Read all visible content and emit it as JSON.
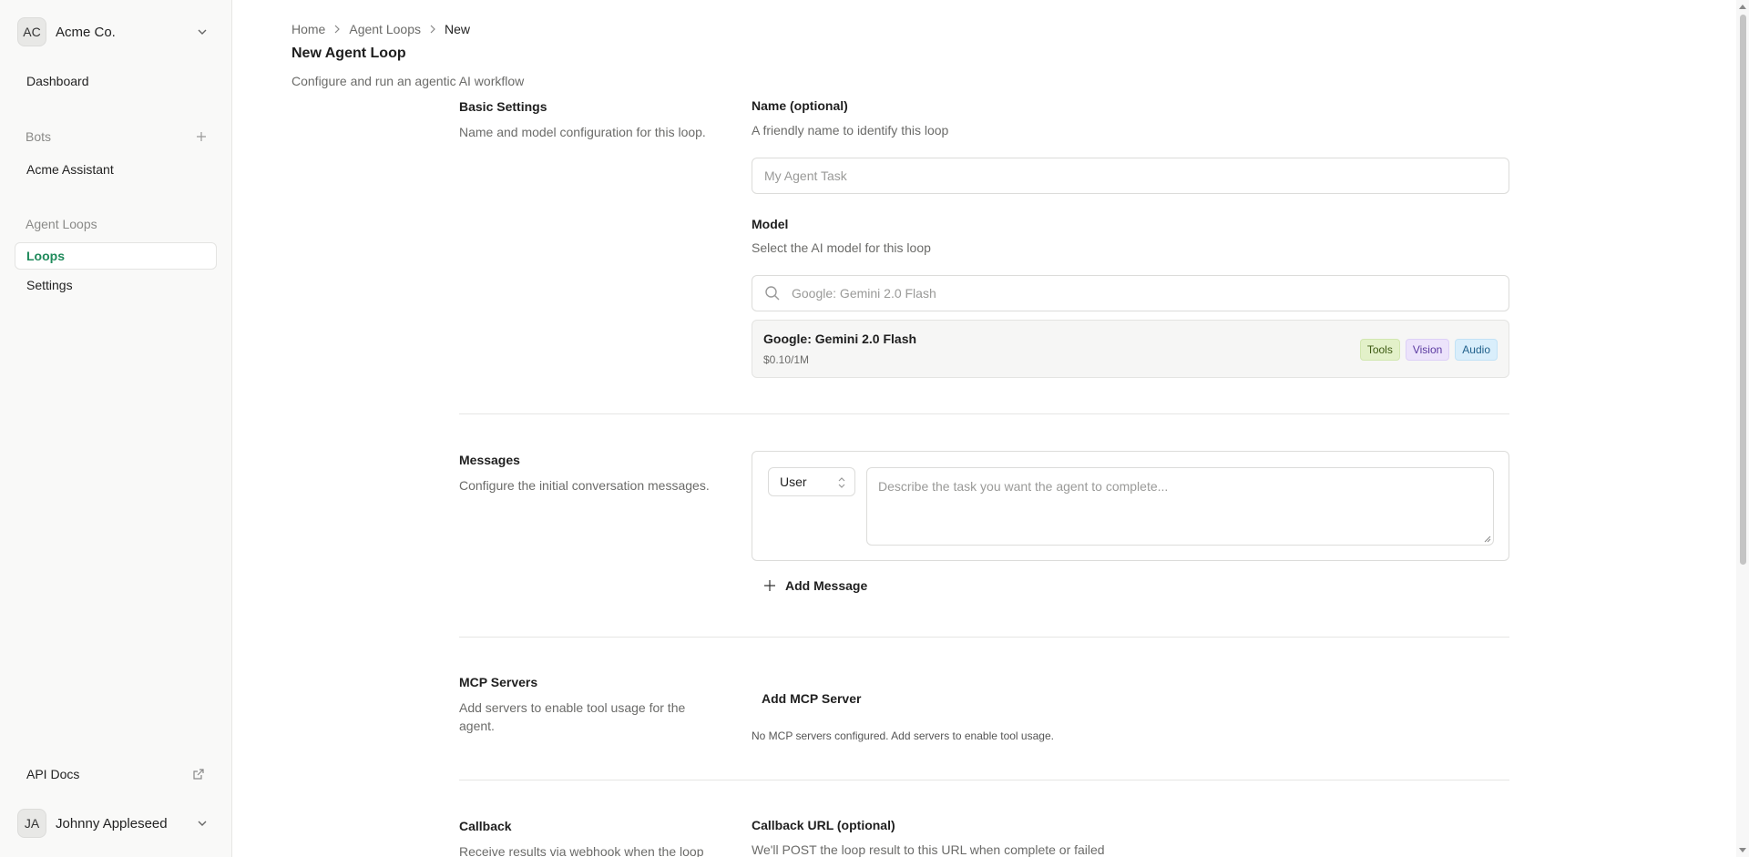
{
  "sidebar": {
    "org": {
      "initials": "AC",
      "name": "Acme Co."
    },
    "dashboard": "Dashboard",
    "bots_label": "Bots",
    "bot_item": "Acme Assistant",
    "agent_loops_label": "Agent Loops",
    "loops": "Loops",
    "settings": "Settings",
    "api_docs": "API Docs",
    "user": {
      "initials": "JA",
      "name": "Johnny Appleseed"
    }
  },
  "breadcrumb": [
    "Home",
    "Agent Loops",
    "New"
  ],
  "page": {
    "title": "New Agent Loop",
    "subtitle": "Configure and run an agentic AI workflow"
  },
  "basic_settings": {
    "title": "Basic Settings",
    "desc": "Name and model configuration for this loop.",
    "name_label": "Name (optional)",
    "name_desc": "A friendly name to identify this loop",
    "name_placeholder": "My Agent Task",
    "model_label": "Model",
    "model_desc": "Select the AI model for this loop",
    "model_search_placeholder": "Google: Gemini 2.0 Flash",
    "selected_model": {
      "name": "Google: Gemini 2.0 Flash",
      "price": "$0.10/1M",
      "badges": [
        "Tools",
        "Vision",
        "Audio"
      ]
    }
  },
  "messages": {
    "title": "Messages",
    "desc": "Configure the initial conversation messages.",
    "role": "User",
    "placeholder": "Describe the task you want the agent to complete...",
    "add_label": "Add Message"
  },
  "mcp": {
    "title": "MCP Servers",
    "desc": "Add servers to enable tool usage for the agent.",
    "add_label": "Add MCP Server",
    "empty": "No MCP servers configured. Add servers to enable tool usage."
  },
  "callback": {
    "title": "Callback",
    "desc": "Receive results via webhook when the loop",
    "url_label": "Callback URL (optional)",
    "url_desc": "We'll POST the loop result to this URL when complete or failed"
  },
  "colors": {
    "accent": "#1f8a5b",
    "badge_tools_bg": "#e3f1c9",
    "badge_vision_bg": "#ece3fb",
    "badge_audio_bg": "#d9eefb"
  }
}
